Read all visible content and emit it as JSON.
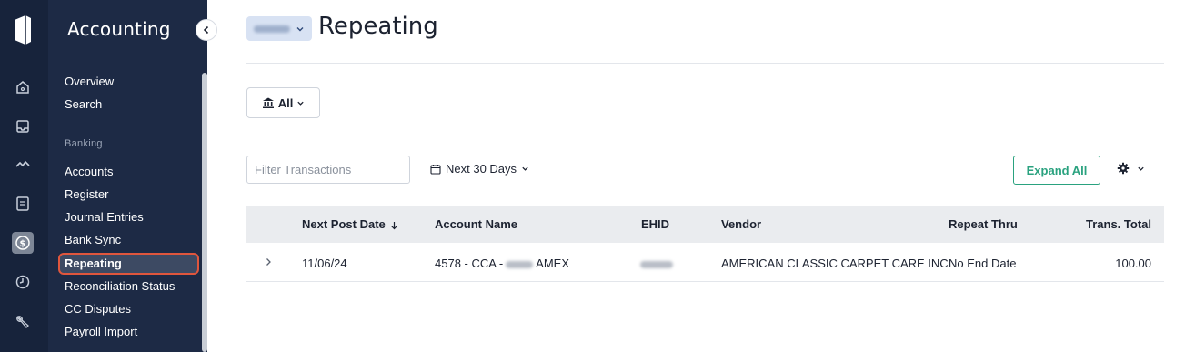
{
  "sidebar": {
    "title": "Accounting",
    "items_top": [
      "Overview",
      "Search"
    ],
    "section_banking": "Banking",
    "items_banking": [
      "Accounts",
      "Register",
      "Journal Entries",
      "Bank Sync"
    ],
    "active_item": "Repeating",
    "items_bottom": [
      "Reconciliation Status",
      "CC Disputes",
      "Payroll Import"
    ]
  },
  "rail_icons": [
    "home-icon",
    "inbox-icon",
    "activity-icon",
    "document-icon",
    "dollar-icon",
    "clock-icon",
    "wrench-icon"
  ],
  "header": {
    "title": "Repeating"
  },
  "filters": {
    "bank_filter_label": "All",
    "search_placeholder": "Filter Transactions",
    "date_range_label": "Next 30 Days",
    "expand_all_label": "Expand All"
  },
  "table": {
    "columns": [
      "Next Post Date",
      "Account Name",
      "EHID",
      "Vendor",
      "Repeat Thru",
      "Trans. Total"
    ],
    "rows": [
      {
        "next_post_date": "11/06/24",
        "account_name_prefix": "4578 - CCA -",
        "account_name_suffix": "AMEX",
        "vendor": "AMERICAN CLASSIC CARPET CARE INC",
        "repeat_thru": "No End Date",
        "trans_total": "100.00"
      }
    ]
  },
  "colors": {
    "rail_bg": "#17233b",
    "sidebar_bg": "#1d2a45",
    "active_outline": "#e0563d",
    "accent_green": "#2aa27f"
  }
}
